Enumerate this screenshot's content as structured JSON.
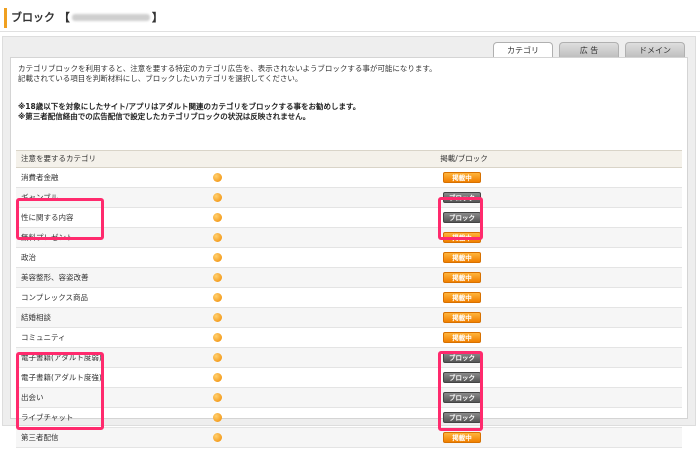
{
  "page": {
    "title_prefix": "ブロック 【",
    "title_suffix": "】"
  },
  "tabs": [
    {
      "label": "カテゴリ",
      "active": true
    },
    {
      "label": "広 告",
      "active": false
    },
    {
      "label": "ドメイン",
      "active": false
    }
  ],
  "intro": {
    "line1": "カテゴリブロックを利用すると、注意を要する特定のカテゴリ広告を、表示されないようブロックする事が可能になります。",
    "line2": "記載されている項目を判断材料にし、ブロックしたいカテゴリを選択してください。"
  },
  "notes": {
    "line1": "※18歳以下を対象にしたサイト/アプリはアダルト関連のカテゴリをブロックする事をお勧めします。",
    "line2": "※第三者配信経由での広告配信で設定したカテゴリブロックの状況は反映されません。"
  },
  "table": {
    "header_category": "注意を要するカテゴリ",
    "header_status": "掲載/ブロック",
    "status_labels": {
      "on": "掲載中",
      "off": "ブロック"
    },
    "rows": [
      {
        "name": "消費者金融",
        "status": "掲載中",
        "blocked": false
      },
      {
        "name": "ギャンブル",
        "status": "ブロック",
        "blocked": true
      },
      {
        "name": "性に関する内容",
        "status": "ブロック",
        "blocked": true
      },
      {
        "name": "無料プレゼント",
        "status": "掲載中",
        "blocked": false
      },
      {
        "name": "政治",
        "status": "掲載中",
        "blocked": false
      },
      {
        "name": "美容整形、容姿改善",
        "status": "掲載中",
        "blocked": false
      },
      {
        "name": "コンプレックス商品",
        "status": "掲載中",
        "blocked": false
      },
      {
        "name": "結婚相談",
        "status": "掲載中",
        "blocked": false
      },
      {
        "name": "コミュニティ",
        "status": "掲載中",
        "blocked": false
      },
      {
        "name": "電子書籍(アダルト度弱)",
        "status": "ブロック",
        "blocked": true
      },
      {
        "name": "電子書籍(アダルト度強)",
        "status": "ブロック",
        "blocked": true
      },
      {
        "name": "出会い",
        "status": "ブロック",
        "blocked": true
      },
      {
        "name": "ライブチャット",
        "status": "ブロック",
        "blocked": true
      },
      {
        "name": "第三者配信",
        "status": "掲載中",
        "blocked": false
      }
    ]
  },
  "colors": {
    "accent": "#f0a020",
    "status_on": "#f08000",
    "status_off": "#555555",
    "highlight": "#ff2a6d"
  }
}
